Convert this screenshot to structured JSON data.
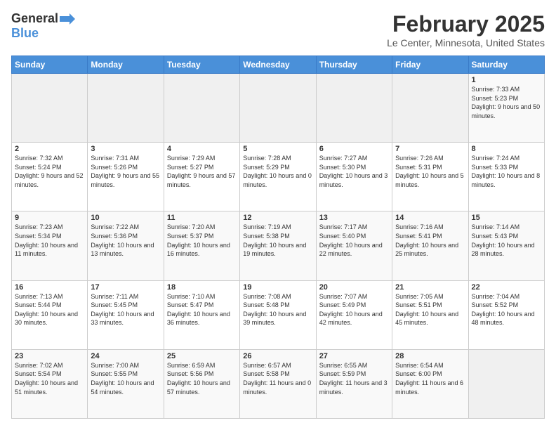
{
  "header": {
    "logo": {
      "general": "General",
      "blue": "Blue",
      "arrow_title": "GeneralBlue logo"
    },
    "title": "February 2025",
    "location": "Le Center, Minnesota, United States"
  },
  "weekdays": [
    "Sunday",
    "Monday",
    "Tuesday",
    "Wednesday",
    "Thursday",
    "Friday",
    "Saturday"
  ],
  "weeks": [
    [
      {
        "day": "",
        "empty": true
      },
      {
        "day": "",
        "empty": true
      },
      {
        "day": "",
        "empty": true
      },
      {
        "day": "",
        "empty": true
      },
      {
        "day": "",
        "empty": true
      },
      {
        "day": "",
        "empty": true
      },
      {
        "day": "1",
        "sunrise": "7:33 AM",
        "sunset": "5:23 PM",
        "daylight": "9 hours and 50 minutes."
      }
    ],
    [
      {
        "day": "2",
        "sunrise": "7:32 AM",
        "sunset": "5:24 PM",
        "daylight": "9 hours and 52 minutes."
      },
      {
        "day": "3",
        "sunrise": "7:31 AM",
        "sunset": "5:26 PM",
        "daylight": "9 hours and 55 minutes."
      },
      {
        "day": "4",
        "sunrise": "7:29 AM",
        "sunset": "5:27 PM",
        "daylight": "9 hours and 57 minutes."
      },
      {
        "day": "5",
        "sunrise": "7:28 AM",
        "sunset": "5:29 PM",
        "daylight": "10 hours and 0 minutes."
      },
      {
        "day": "6",
        "sunrise": "7:27 AM",
        "sunset": "5:30 PM",
        "daylight": "10 hours and 3 minutes."
      },
      {
        "day": "7",
        "sunrise": "7:26 AM",
        "sunset": "5:31 PM",
        "daylight": "10 hours and 5 minutes."
      },
      {
        "day": "8",
        "sunrise": "7:24 AM",
        "sunset": "5:33 PM",
        "daylight": "10 hours and 8 minutes."
      }
    ],
    [
      {
        "day": "9",
        "sunrise": "7:23 AM",
        "sunset": "5:34 PM",
        "daylight": "10 hours and 11 minutes."
      },
      {
        "day": "10",
        "sunrise": "7:22 AM",
        "sunset": "5:36 PM",
        "daylight": "10 hours and 13 minutes."
      },
      {
        "day": "11",
        "sunrise": "7:20 AM",
        "sunset": "5:37 PM",
        "daylight": "10 hours and 16 minutes."
      },
      {
        "day": "12",
        "sunrise": "7:19 AM",
        "sunset": "5:38 PM",
        "daylight": "10 hours and 19 minutes."
      },
      {
        "day": "13",
        "sunrise": "7:17 AM",
        "sunset": "5:40 PM",
        "daylight": "10 hours and 22 minutes."
      },
      {
        "day": "14",
        "sunrise": "7:16 AM",
        "sunset": "5:41 PM",
        "daylight": "10 hours and 25 minutes."
      },
      {
        "day": "15",
        "sunrise": "7:14 AM",
        "sunset": "5:43 PM",
        "daylight": "10 hours and 28 minutes."
      }
    ],
    [
      {
        "day": "16",
        "sunrise": "7:13 AM",
        "sunset": "5:44 PM",
        "daylight": "10 hours and 30 minutes."
      },
      {
        "day": "17",
        "sunrise": "7:11 AM",
        "sunset": "5:45 PM",
        "daylight": "10 hours and 33 minutes."
      },
      {
        "day": "18",
        "sunrise": "7:10 AM",
        "sunset": "5:47 PM",
        "daylight": "10 hours and 36 minutes."
      },
      {
        "day": "19",
        "sunrise": "7:08 AM",
        "sunset": "5:48 PM",
        "daylight": "10 hours and 39 minutes."
      },
      {
        "day": "20",
        "sunrise": "7:07 AM",
        "sunset": "5:49 PM",
        "daylight": "10 hours and 42 minutes."
      },
      {
        "day": "21",
        "sunrise": "7:05 AM",
        "sunset": "5:51 PM",
        "daylight": "10 hours and 45 minutes."
      },
      {
        "day": "22",
        "sunrise": "7:04 AM",
        "sunset": "5:52 PM",
        "daylight": "10 hours and 48 minutes."
      }
    ],
    [
      {
        "day": "23",
        "sunrise": "7:02 AM",
        "sunset": "5:54 PM",
        "daylight": "10 hours and 51 minutes."
      },
      {
        "day": "24",
        "sunrise": "7:00 AM",
        "sunset": "5:55 PM",
        "daylight": "10 hours and 54 minutes."
      },
      {
        "day": "25",
        "sunrise": "6:59 AM",
        "sunset": "5:56 PM",
        "daylight": "10 hours and 57 minutes."
      },
      {
        "day": "26",
        "sunrise": "6:57 AM",
        "sunset": "5:58 PM",
        "daylight": "11 hours and 0 minutes."
      },
      {
        "day": "27",
        "sunrise": "6:55 AM",
        "sunset": "5:59 PM",
        "daylight": "11 hours and 3 minutes."
      },
      {
        "day": "28",
        "sunrise": "6:54 AM",
        "sunset": "6:00 PM",
        "daylight": "11 hours and 6 minutes."
      },
      {
        "day": "",
        "empty": true
      }
    ]
  ]
}
